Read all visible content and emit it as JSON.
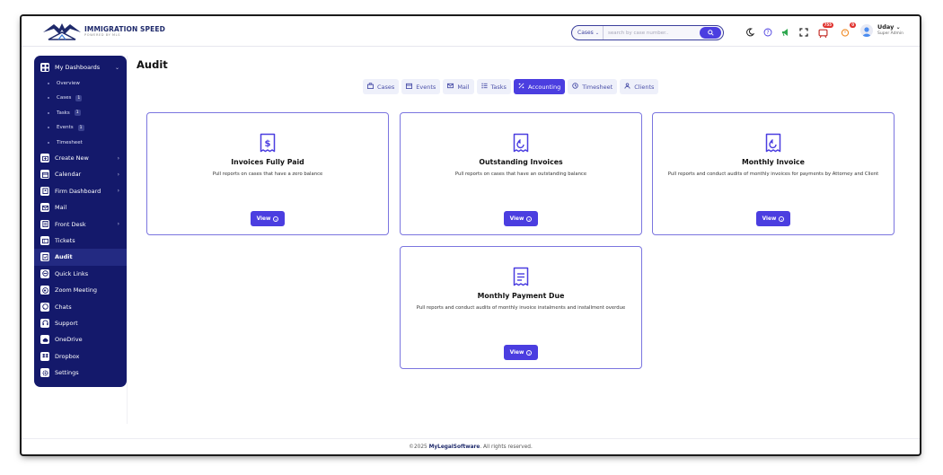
{
  "app": {
    "logo_title": "IMMIGRATION SPEED",
    "logo_subtitle": "POWERED BY MLS"
  },
  "header": {
    "search": {
      "scope": "Cases",
      "placeholder": "search by case number.."
    },
    "icons": [
      "moon-icon",
      "help-icon",
      "megaphone-icon",
      "fullscreen-icon",
      "notifications-icon",
      "reminders-icon"
    ],
    "notification_count": "755",
    "reminder_count": "0",
    "user": {
      "name": "Uday",
      "role": "Super Admin"
    }
  },
  "sidebar": {
    "dashboards": {
      "label": "My Dashboards",
      "icon": "dashboard-icon"
    },
    "sub_items": [
      {
        "label": "Overview",
        "count": ""
      },
      {
        "label": "Cases",
        "count": "1"
      },
      {
        "label": "Tasks",
        "count": "1"
      },
      {
        "label": "Events",
        "count": "1"
      },
      {
        "label": "Timesheet",
        "count": ""
      }
    ],
    "items": [
      {
        "label": "Create New",
        "icon": "plus-box-icon",
        "has_children": true
      },
      {
        "label": "Calendar",
        "icon": "calendar-icon",
        "has_children": true
      },
      {
        "label": "Firm Dashboard",
        "icon": "firm-icon",
        "has_children": true
      },
      {
        "label": "Mail",
        "icon": "mail-icon",
        "has_children": false
      },
      {
        "label": "Front Desk",
        "icon": "front-desk-icon",
        "has_children": true
      },
      {
        "label": "Tickets",
        "icon": "ticket-icon",
        "has_children": false
      },
      {
        "label": "Audit",
        "icon": "audit-icon",
        "has_children": false,
        "active": true
      },
      {
        "label": "Quick Links",
        "icon": "link-icon",
        "has_children": false
      },
      {
        "label": "Zoom Meeting",
        "icon": "video-icon",
        "has_children": false
      },
      {
        "label": "Chats",
        "icon": "chat-icon",
        "has_children": false
      },
      {
        "label": "Support",
        "icon": "headset-icon",
        "has_children": false
      },
      {
        "label": "OneDrive",
        "icon": "cloud-icon",
        "has_children": false
      },
      {
        "label": "Dropbox",
        "icon": "dropbox-icon",
        "has_children": false
      },
      {
        "label": "Settings",
        "icon": "gear-icon",
        "has_children": false
      }
    ]
  },
  "main": {
    "title": "Audit",
    "tabs": [
      {
        "label": "Cases",
        "icon": "briefcase-icon"
      },
      {
        "label": "Events",
        "icon": "calendar-icon"
      },
      {
        "label": "Mail",
        "icon": "mail-icon"
      },
      {
        "label": "Tasks",
        "icon": "tasks-icon"
      },
      {
        "label": "Accounting",
        "icon": "percent-icon",
        "active": true
      },
      {
        "label": "Timesheet",
        "icon": "clock-icon"
      },
      {
        "label": "Clients",
        "icon": "clients-icon"
      }
    ],
    "cards": [
      {
        "title": "Invoices Fully Paid",
        "description": "Pull reports on cases that have a zero balance",
        "button": "View",
        "icon": "receipt-dollar-icon"
      },
      {
        "title": "Outstanding Invoices",
        "description": "Pull reports on cases that have an outstanding balance",
        "button": "View",
        "icon": "receipt-return-icon"
      },
      {
        "title": "Monthly Invoice",
        "description": "Pull reports and conduct audits of monthly invoices for payments by Attorney and Client",
        "button": "View",
        "icon": "receipt-return-icon"
      },
      {
        "title": "Monthly Payment Due",
        "description": "Pull reports and conduct audits of monthly invoice instalments and installment overdue",
        "button": "View",
        "icon": "receipt-list-icon"
      }
    ]
  },
  "footer": {
    "prefix": "©2025",
    "brand": "MyLegalSoftware",
    "suffix": ". All rights reserved."
  },
  "colors": {
    "accent": "#4b3ee0",
    "sidebar": "#14196b",
    "card_border": "#7b75df"
  }
}
